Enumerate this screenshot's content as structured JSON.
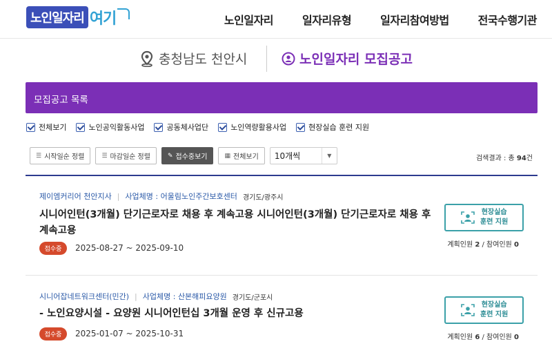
{
  "header": {
    "logo_main": "노인일자리",
    "logo_sub": "여기",
    "nav": [
      "노인일자리",
      "일자리유형",
      "일자리참여방법",
      "전국수행기관"
    ]
  },
  "region": {
    "location": "충청남도 천안시",
    "section": "노인일자리 모집공고"
  },
  "list": {
    "title": "모집공고 목록",
    "filters": [
      "전체보기",
      "노인공익활동사업",
      "공동체사업단",
      "노인역량활용사업",
      "현장실습 훈련 지원"
    ],
    "toolbar": {
      "sort_start": "시작일순 정렬",
      "sort_end": "마감일순 정렬",
      "show_open": "접수중보기",
      "show_all": "전체보기",
      "page_size": "10개씩"
    },
    "total_label": "검색결과 : 총 ",
    "total_count": "94",
    "total_unit": "건"
  },
  "items": [
    {
      "org": "제이엠커리어 천안지사",
      "biz_label": "사업체명 : ",
      "biz": "어울림노인주간보호센터",
      "location": "경기도/광주시",
      "title": "시니어인턴(3개월) 단기근로자로 채용 후 계속고용 시니어인턴(3개월) 단기근로자로 채용 후 계속고용",
      "status": "접수중",
      "period": "2025-08-27 ~ 2025-09-10",
      "support_line1": "현장실습",
      "support_line2": "훈련 지원",
      "plan_label": "계획인원 ",
      "plan": "2",
      "sep": " / ",
      "join_label": "참여인원 ",
      "join": "0"
    },
    {
      "org": "시니어잡네트워크센터(민간)",
      "biz_label": "사업체명 : ",
      "biz": "산본해피요양원",
      "location": "경기도/군포시",
      "title": "- 노인요양시설 - 요양원 시니어인턴십 3개월 운영 후 신규고용",
      "status": "접수중",
      "period": "2025-01-07 ~ 2025-10-31",
      "support_line1": "현장실습",
      "support_line2": "훈련 지원",
      "plan_label": "계획인원 ",
      "plan": "6",
      "sep": " / ",
      "join_label": "참여인원 ",
      "join": "0"
    }
  ],
  "colors": {
    "purple": "#7b2fb6",
    "navy": "#2c3a8e",
    "badge": "#d54a2c",
    "teal": "#3aa0a8"
  }
}
